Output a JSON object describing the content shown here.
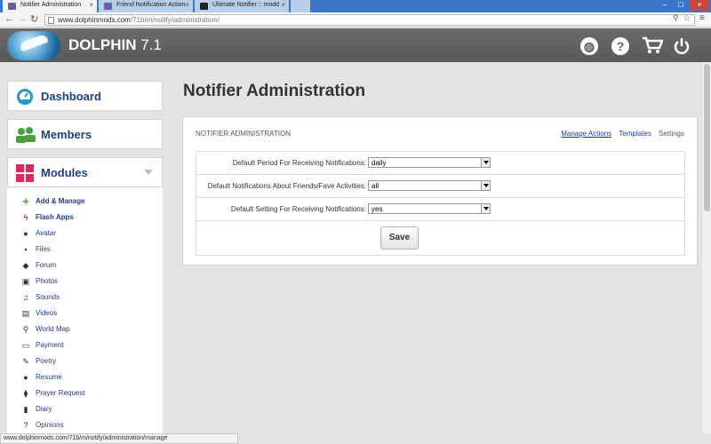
{
  "browser": {
    "tabs": [
      {
        "title": "Notifier Administration",
        "active": true
      },
      {
        "title": "Friend Notification Action",
        "active": false
      },
      {
        "title": "Ultimate Notifier :: modd",
        "active": false
      }
    ],
    "url_domain": "www.dolphinmods.com",
    "url_path": "/71b/m/notify/administration/",
    "status_url": "www.dolphinmods.com/71b/m/notify/administration/manage"
  },
  "header": {
    "brand_name": "DOLPHIN",
    "brand_version": "7.1",
    "icons": [
      "globe-icon",
      "help-icon",
      "cart-icon",
      "power-icon"
    ]
  },
  "sidebar": {
    "dashboard": {
      "label": "Dashboard",
      "icon": "dashboard-icon",
      "color": "#2a96c9"
    },
    "members": {
      "label": "Members",
      "icon": "members-icon",
      "color": "#47a23c"
    },
    "modules": {
      "label": "Modules",
      "icon": "modules-icon",
      "color": "#e0275f"
    },
    "module_items": [
      {
        "label": "Add & Manage",
        "icon": "plus-icon",
        "bold": true
      },
      {
        "label": "Flash Apps",
        "icon": "bolt-icon",
        "bold": true
      },
      {
        "label": "Avatar",
        "icon": "user-icon",
        "bold": false
      },
      {
        "label": "Files",
        "icon": "save-icon",
        "bold": false
      },
      {
        "label": "Forum",
        "icon": "comments-icon",
        "bold": false
      },
      {
        "label": "Photos",
        "icon": "picture-icon",
        "bold": false
      },
      {
        "label": "Sounds",
        "icon": "music-icon",
        "bold": false
      },
      {
        "label": "Videos",
        "icon": "film-icon",
        "bold": false
      },
      {
        "label": "World Map",
        "icon": "map-marker-icon",
        "bold": false
      },
      {
        "label": "Payment",
        "icon": "credit-card-icon",
        "bold": false
      },
      {
        "label": "Poetry",
        "icon": "pencil-icon",
        "bold": false
      },
      {
        "label": "Resume",
        "icon": "user-icon",
        "bold": false
      },
      {
        "label": "Prayer Request",
        "icon": "tag-icon",
        "bold": false
      },
      {
        "label": "Diary",
        "icon": "book-icon",
        "bold": false
      },
      {
        "label": "Opinions",
        "icon": "question-icon",
        "bold": false
      }
    ]
  },
  "main": {
    "title": "Notifier Administration",
    "panel_caption": "NOTIFIER ADMINISTRATION",
    "links": {
      "manage_actions": "Manage Actions",
      "templates": "Templates",
      "settings": "Settings"
    },
    "fields": [
      {
        "label": "Default Period For Receiving Notifications:",
        "value": "daily"
      },
      {
        "label": "Default Notifications About Friends/Fave Activities:",
        "value": "all"
      },
      {
        "label": "Default Setting For Receiving Notifications:",
        "value": "yes"
      }
    ],
    "save_label": "Save"
  }
}
